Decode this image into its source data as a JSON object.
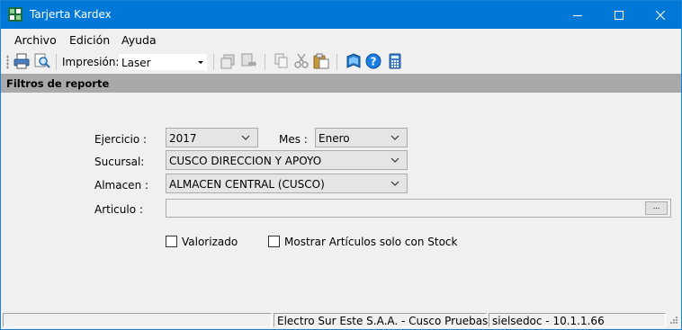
{
  "window": {
    "title": "Tarjerta Kardex"
  },
  "menu": {
    "items": [
      "Archivo",
      "Edición",
      "Ayuda"
    ]
  },
  "toolbar": {
    "print_label": "Impresión:",
    "printer_value": "Laser"
  },
  "section": {
    "title": "Filtros de reporte"
  },
  "form": {
    "ejercicio_label": "Ejercicio :",
    "ejercicio_value": "2017",
    "mes_label": "Mes :",
    "mes_value": "Enero",
    "sucursal_label": "Sucursal:",
    "sucursal_value": "CUSCO DIRECCION Y APOYO",
    "almacen_label": "Almacen :",
    "almacen_value": "ALMACEN CENTRAL (CUSCO)",
    "articulo_label": "Articulo :",
    "articulo_value": "",
    "articulo_button": "...",
    "valorizado_label": "Valorizado",
    "valorizado_checked": false,
    "stock_label": "Mostrar Artículos solo con Stock",
    "stock_checked": false
  },
  "status": {
    "panel1": "",
    "panel2": "Electro Sur Este S.A.A. - Cusco Pruebas",
    "panel3": "sielsedoc - 10.1.1.66"
  },
  "colors": {
    "titlebar": "#0078d7",
    "section_header": "#a9a9a9",
    "background": "#f0f0f0"
  }
}
